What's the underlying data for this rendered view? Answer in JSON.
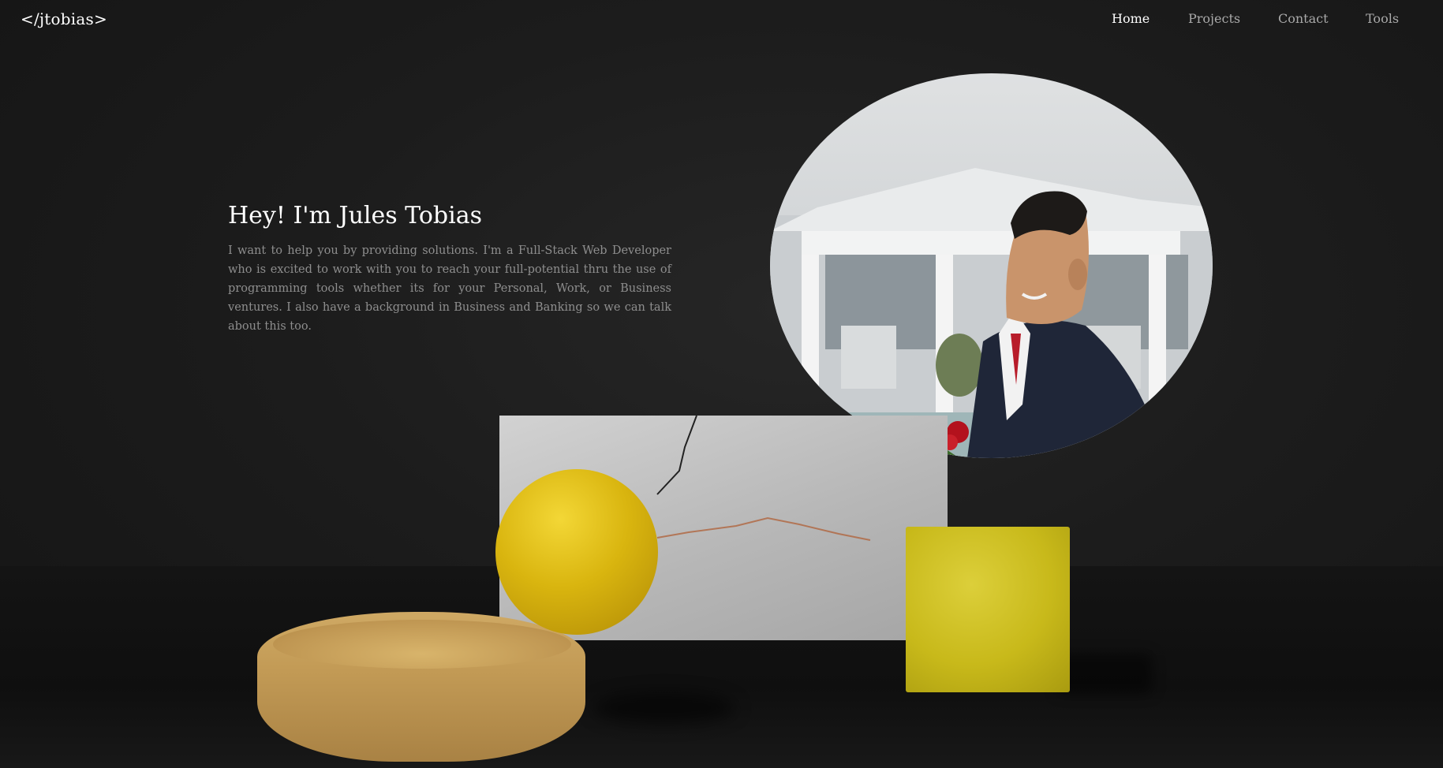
{
  "header": {
    "logo": "</jtobias>",
    "nav": [
      {
        "label": "Home",
        "active": true
      },
      {
        "label": "Projects",
        "active": false
      },
      {
        "label": "Contact",
        "active": false
      },
      {
        "label": "Tools",
        "active": false
      }
    ]
  },
  "hero": {
    "title": "Hey! I'm Jules Tobias",
    "description": "I want to help you by providing solutions. I'm a Full-Stack Web Developer who is excited to work with you to reach your full-potential thru the use of programming tools whether its for your Personal, Work, or Business ventures. I also have a background in Business and Banking so we can talk about this too."
  },
  "colors": {
    "background": "#181818",
    "text_primary": "#ffffff",
    "text_muted": "#8e8e8e",
    "accent_yellow": "#d9b50f"
  }
}
